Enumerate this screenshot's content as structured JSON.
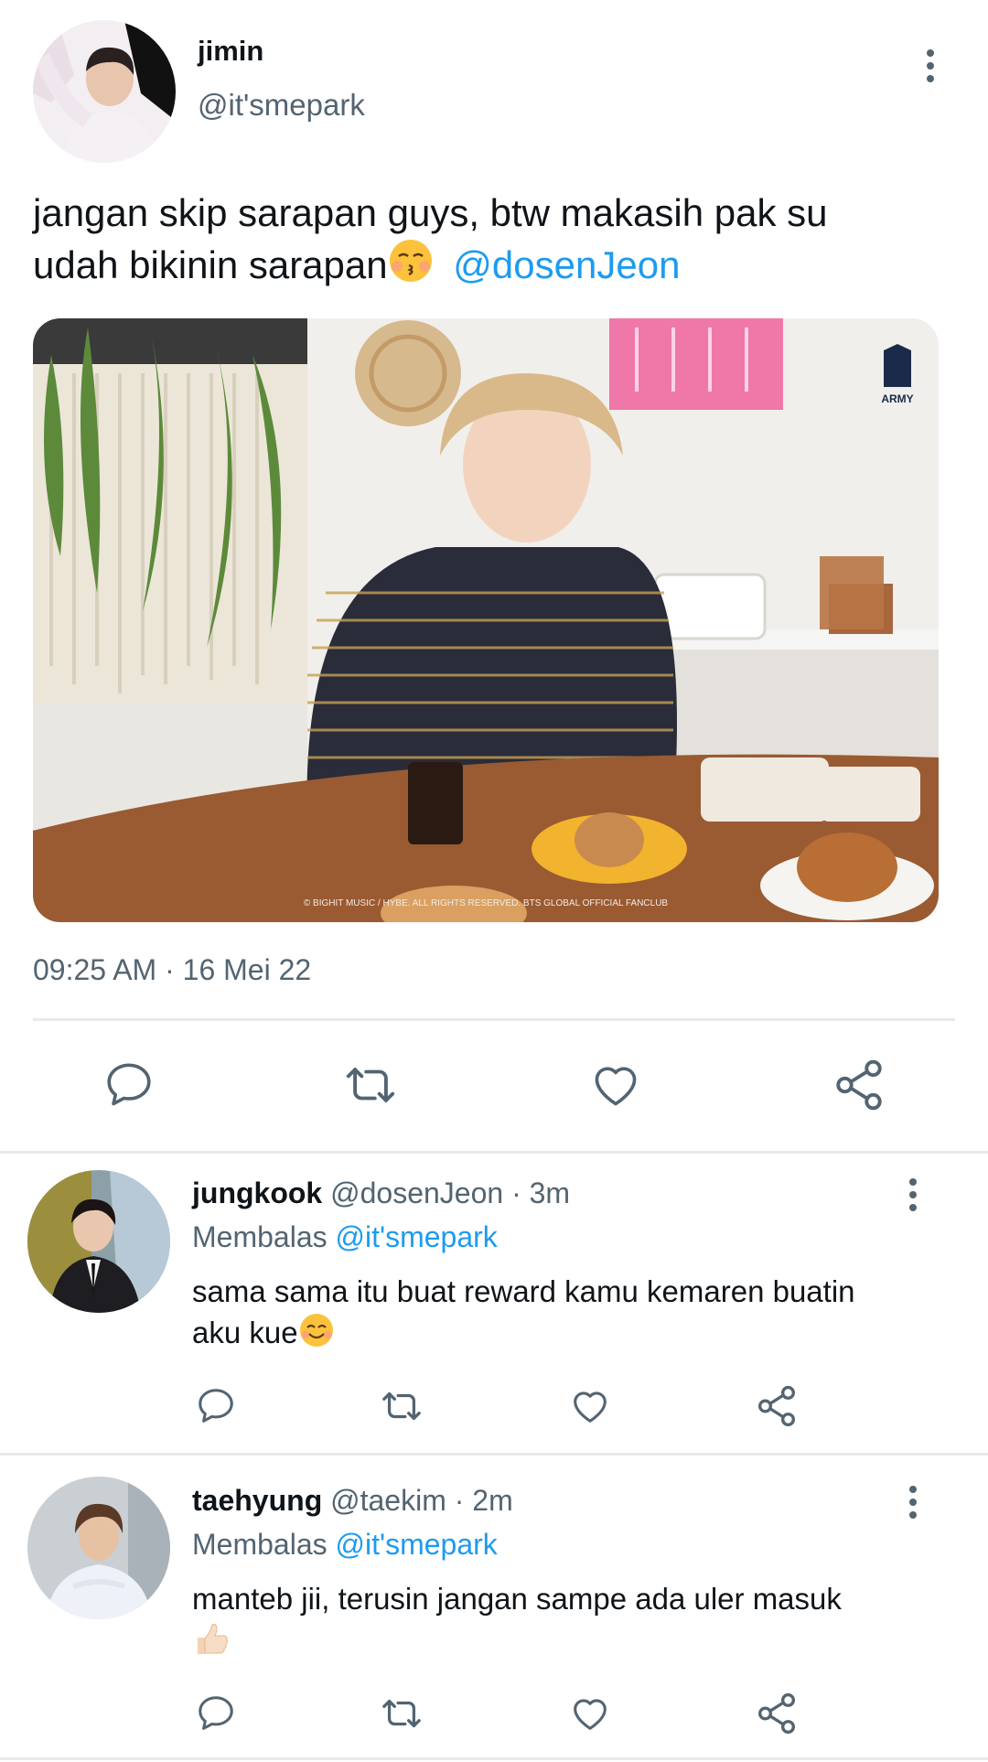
{
  "tweet": {
    "author_name": "jimin",
    "author_handle": "@it'smepark",
    "text_line1": "jangan skip sarapan guys, btw makasih pak su",
    "text_line2": "udah bikinin sarapan",
    "mention": "@dosenJeon",
    "image_caption": "© BIGHIT MUSIC / HYBE. ALL RIGHTS RESERVED. BTS GLOBAL OFFICIAL FANCLUB",
    "army_logo_text": "ARMY",
    "timestamp": "09:25 AM · 16 Mei 22"
  },
  "replies": [
    {
      "name": "jungkook",
      "meta": "@dosenJeon · 3m",
      "reply_prefix": "Membalas",
      "reply_to": "@it'smepark",
      "text_line1": "sama sama itu buat reward kamu kemaren buatin",
      "text_line2": "aku kue"
    },
    {
      "name": "taehyung",
      "meta": "@taekim · 2m",
      "reply_prefix": "Membalas",
      "reply_to": "@it'smepark",
      "text_line1": "manteb jii, terusin jangan sampe ada uler masuk",
      "text_line2": ""
    }
  ],
  "icons": [
    "comment-icon",
    "retweet-icon",
    "like-icon",
    "share-icon",
    "more-icon",
    "kissing-emoji",
    "smiling-emoji",
    "thumbs-up-emoji"
  ],
  "colors": {
    "link": "#1d9bf0",
    "muted": "#536471",
    "text": "#0f1419",
    "divider": "#e7e9ea"
  }
}
